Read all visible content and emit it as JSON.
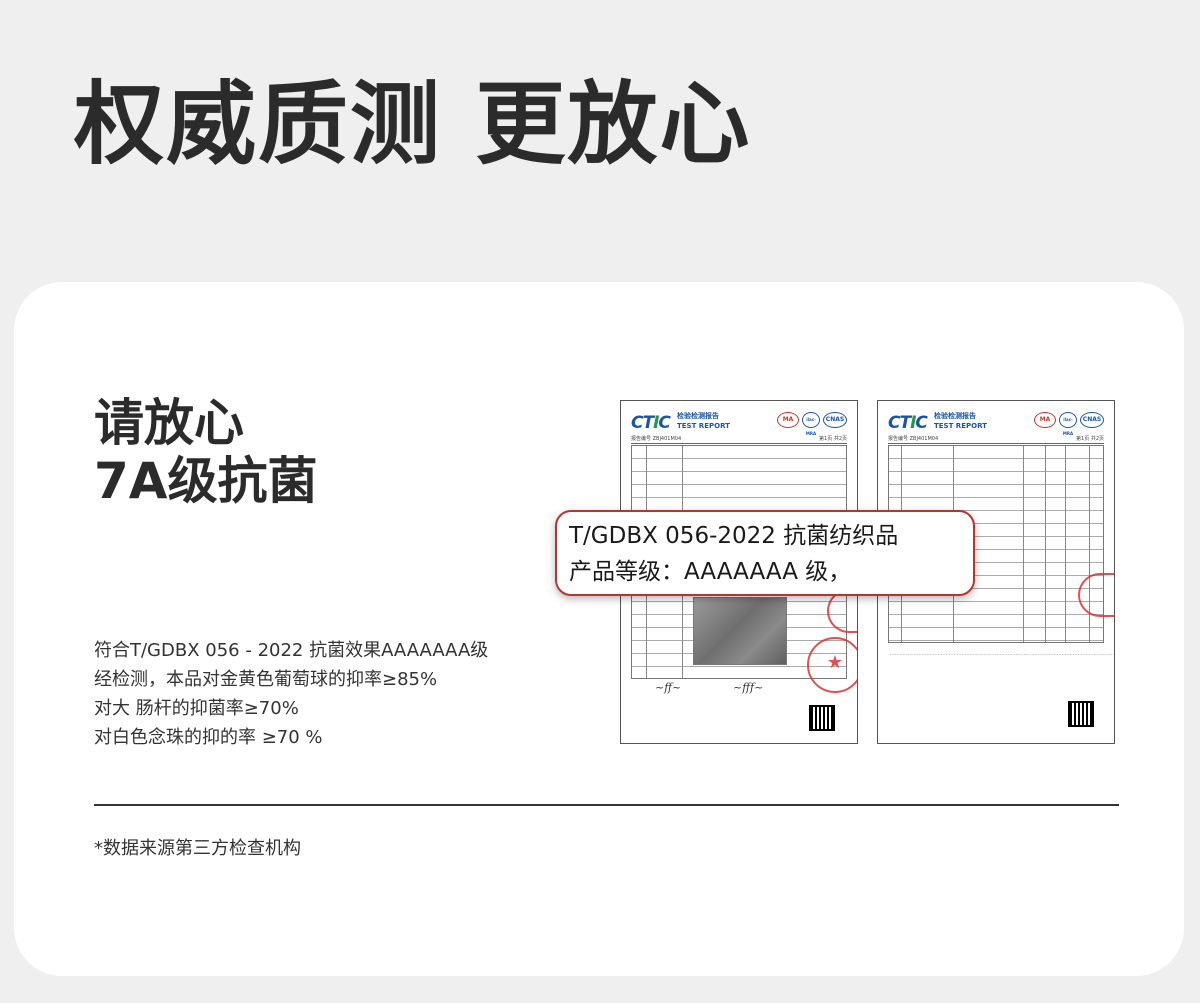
{
  "headline": "权威质测 更放心",
  "card": {
    "subtitle_line1": "请放心",
    "subtitle_line2": "7A级抗菌",
    "description": [
      "符合T/GDBX 056 - 2022 抗菌效果AAAAAAA级",
      "经检测，本品对金黄色葡萄球的抑率≥85%",
      "对大 肠杆的抑菌率≥70%",
      "对白色念珠的抑的率 ≥70 %"
    ],
    "footnote": "*数据来源第三方检查机构"
  },
  "callout": {
    "line1": "T/GDBX 056-2022  抗菌纺织品",
    "line2": "产品等级：AAAAAAA 级，"
  },
  "reports": {
    "logo_ct": "CT",
    "logo_i": "I",
    "logo_c": "C",
    "title_cn": "检验检测报告",
    "title_en": "TEST REPORT",
    "mark_ma": "MA",
    "mark_ilac": "ilac-MRA",
    "mark_cnas": "CNAS",
    "report_no": "报告编号 ZBJ401M04",
    "page1": "第1页 共2页",
    "page2": "第1页 共2页",
    "stamp_glyph": "★"
  },
  "colors": {
    "brand_blue": "#1c55a8",
    "brand_green": "#1f9a4a",
    "stamp_red": "#d33333",
    "callout_border": "#b3372d"
  }
}
